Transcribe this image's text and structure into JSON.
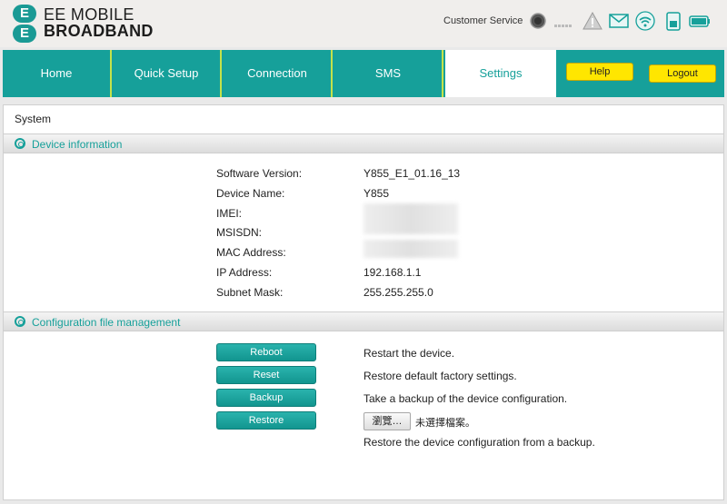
{
  "brand": {
    "mark_top": "E",
    "mark_bottom": "E",
    "line1": "EE MOBILE",
    "line2": "BROADBAND",
    "color": "#1a9a95"
  },
  "header": {
    "customer_service": "Customer Service",
    "icons": [
      "power-icon",
      "signal-icon",
      "warning-icon",
      "mail-icon",
      "wifi-icon",
      "sim-icon",
      "battery-icon"
    ]
  },
  "nav": {
    "tabs": [
      {
        "label": "Home"
      },
      {
        "label": "Quick Setup"
      },
      {
        "label": "Connection"
      },
      {
        "label": "SMS"
      },
      {
        "label": "Settings",
        "active": true
      }
    ],
    "help": "Help",
    "logout": "Logout",
    "accent": "#16a09a",
    "button_color": "#ffe600"
  },
  "page": {
    "title": "System"
  },
  "device_info": {
    "title": "Device information",
    "rows": [
      {
        "label": "Software Version:",
        "value": "Y855_E1_01.16_13"
      },
      {
        "label": "Device Name:",
        "value": "Y855"
      },
      {
        "label": "IMEI:",
        "value": ""
      },
      {
        "label": "MSISDN:",
        "value": ""
      },
      {
        "label": "MAC Address:",
        "value": ""
      },
      {
        "label": "IP Address:",
        "value": "192.168.1.1"
      },
      {
        "label": "Subnet Mask:",
        "value": "255.255.255.0"
      }
    ]
  },
  "config": {
    "title": "Configuration file management",
    "actions": [
      {
        "button": "Reboot",
        "desc": "Restart the device."
      },
      {
        "button": "Reset",
        "desc": "Restore default factory settings."
      },
      {
        "button": "Backup",
        "desc": "Take a backup of the device configuration."
      },
      {
        "button": "Restore",
        "desc": "Restore the device configuration from a backup."
      }
    ],
    "browse_label": "瀏覽…",
    "no_file": "未選擇檔案。"
  }
}
